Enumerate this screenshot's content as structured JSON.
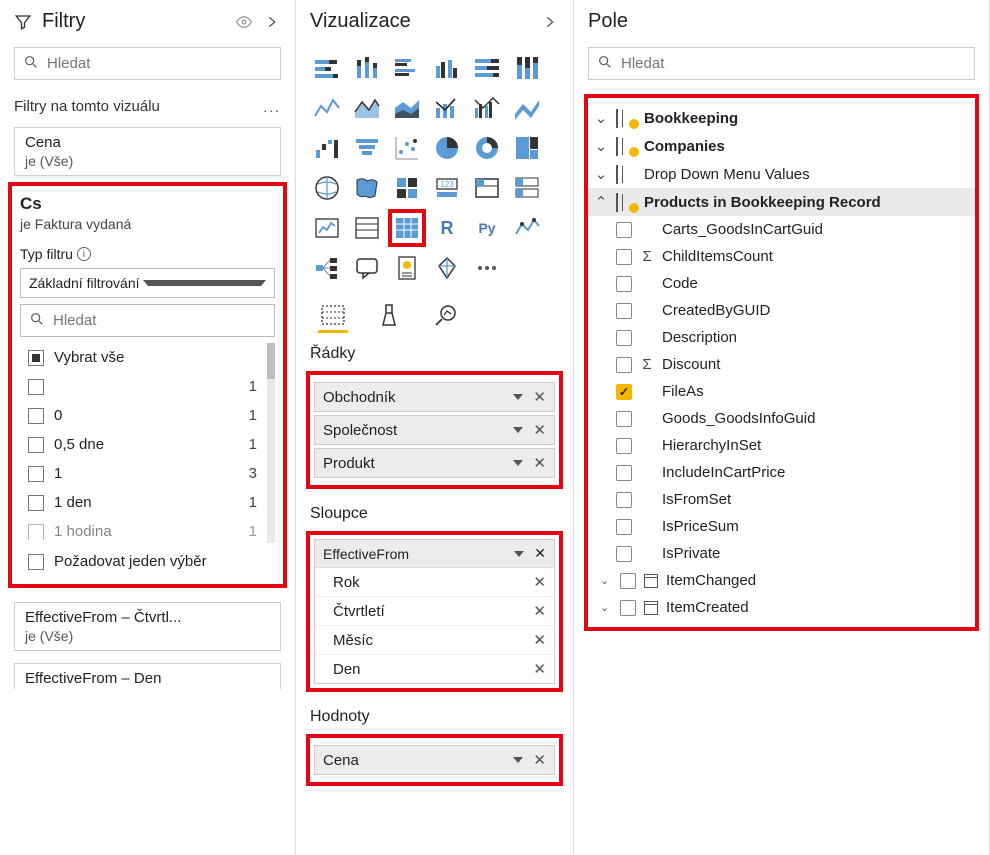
{
  "filters": {
    "title": "Filtry",
    "search_placeholder": "Hledat",
    "section_label": "Filtry na tomto vizuálu",
    "card1": {
      "title": "Cena",
      "sub": "je (Vše)"
    },
    "cs": {
      "title": "Cs",
      "sub": "je Faktura vydaná",
      "typ_label": "Typ filtru",
      "select_value": "Základní filtrování",
      "search_placeholder": "Hledat",
      "select_all": "Vybrat vše",
      "items": [
        {
          "label": "",
          "count": 1
        },
        {
          "label": "0",
          "count": 1
        },
        {
          "label": "0,5 dne",
          "count": 1
        },
        {
          "label": "1",
          "count": 3
        },
        {
          "label": "1 den",
          "count": 1
        },
        {
          "label": "1 hodina",
          "count": 1
        }
      ],
      "require_one": "Požadovat jeden výběr"
    },
    "card2": {
      "title": "EffectiveFrom – Čtvrtl...",
      "sub": "je (Vše)"
    },
    "card3": {
      "title": "EffectiveFrom – Den"
    }
  },
  "viz": {
    "title": "Vizualizace",
    "rows_label": "Řádky",
    "rows": [
      "Obchodník",
      "Společnost",
      "Produkt"
    ],
    "cols_label": "Sloupce",
    "cols_header": "EffectiveFrom",
    "cols": [
      "Rok",
      "Čtvrtletí",
      "Měsíc",
      "Den"
    ],
    "values_label": "Hodnoty",
    "values": [
      "Cena"
    ]
  },
  "fields": {
    "title": "Pole",
    "search_placeholder": "Hledat",
    "tables": [
      {
        "name": "Bookkeeping",
        "expanded": false,
        "yellow": true
      },
      {
        "name": "Companies",
        "expanded": false,
        "yellow": true
      },
      {
        "name": "Drop Down Menu Values",
        "expanded": false,
        "yellow": false
      },
      {
        "name": "Products in Bookkeeping Record",
        "expanded": true,
        "yellow": true,
        "selected": true
      }
    ],
    "columns": [
      {
        "name": "Carts_GoodsInCartGuid"
      },
      {
        "name": "ChildItemsCount",
        "sigma": true
      },
      {
        "name": "Code"
      },
      {
        "name": "CreatedByGUID"
      },
      {
        "name": "Description"
      },
      {
        "name": "Discount",
        "sigma": true
      },
      {
        "name": "FileAs",
        "checked": true
      },
      {
        "name": "Goods_GoodsInfoGuid"
      },
      {
        "name": "HierarchyInSet"
      },
      {
        "name": "IncludeInCartPrice"
      },
      {
        "name": "IsFromSet"
      },
      {
        "name": "IsPriceSum"
      },
      {
        "name": "IsPrivate"
      },
      {
        "name": "ItemChanged",
        "date": true
      },
      {
        "name": "ItemCreated",
        "date": true
      }
    ]
  }
}
